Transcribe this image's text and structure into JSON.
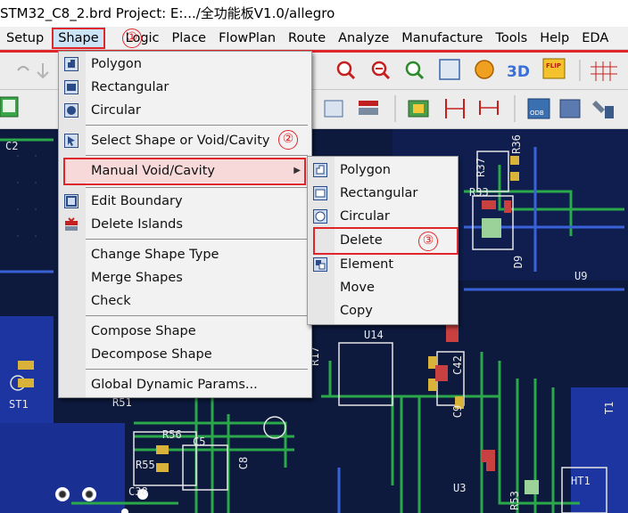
{
  "window": {
    "title": "STM32_C8_2.brd  Project: E:.../全功能板V1.0/allegro"
  },
  "menubar": {
    "items": [
      "Setup",
      "Shape",
      "Logic",
      "Place",
      "FlowPlan",
      "Route",
      "Analyze",
      "Manufacture",
      "Tools",
      "Help",
      "EDA"
    ],
    "active": "Shape"
  },
  "shape_menu": {
    "items": [
      {
        "label": "Polygon",
        "icon": "polygon-icon"
      },
      {
        "label": "Rectangular",
        "icon": "rectangle-icon"
      },
      {
        "label": "Circular",
        "icon": "circle-icon"
      },
      {
        "label": "Select Shape or Void/Cavity",
        "icon": "select-shape-icon"
      },
      {
        "label": "Manual Void/Cavity",
        "icon": "",
        "submenu": true
      },
      {
        "label": "Edit Boundary",
        "icon": "edit-boundary-icon"
      },
      {
        "label": "Delete Islands",
        "icon": "delete-islands-icon"
      },
      {
        "label": "Change Shape Type",
        "icon": ""
      },
      {
        "label": "Merge Shapes",
        "icon": ""
      },
      {
        "label": "Check",
        "icon": ""
      },
      {
        "label": "Compose Shape",
        "icon": ""
      },
      {
        "label": "Decompose Shape",
        "icon": ""
      },
      {
        "label": "Global Dynamic Params...",
        "icon": ""
      }
    ]
  },
  "void_submenu": {
    "items": [
      {
        "label": "Polygon",
        "icon": "void-polygon-icon"
      },
      {
        "label": "Rectangular",
        "icon": "void-rectangle-icon"
      },
      {
        "label": "Circular",
        "icon": "void-circle-icon"
      },
      {
        "label": "Delete",
        "icon": ""
      },
      {
        "label": "Element",
        "icon": "void-element-icon"
      },
      {
        "label": "Move",
        "icon": ""
      },
      {
        "label": "Copy",
        "icon": ""
      }
    ]
  },
  "annotations": {
    "step1": "①",
    "step2": "②",
    "step3": "③"
  },
  "pcb_labels": [
    "C2",
    "R37",
    "R36",
    "R33",
    "D9",
    "U9",
    "U14",
    "R17",
    "C42",
    "C9",
    "ST1",
    "R51",
    "R56",
    "C5",
    "R55",
    "C8",
    "U3",
    "HT1",
    "C38",
    "R53",
    "T1"
  ],
  "colors": {
    "highlight": "#e0262b",
    "board": "#0d1a3d",
    "trace_green": "#2aa84a",
    "trace_blue": "#2a4fb8"
  }
}
